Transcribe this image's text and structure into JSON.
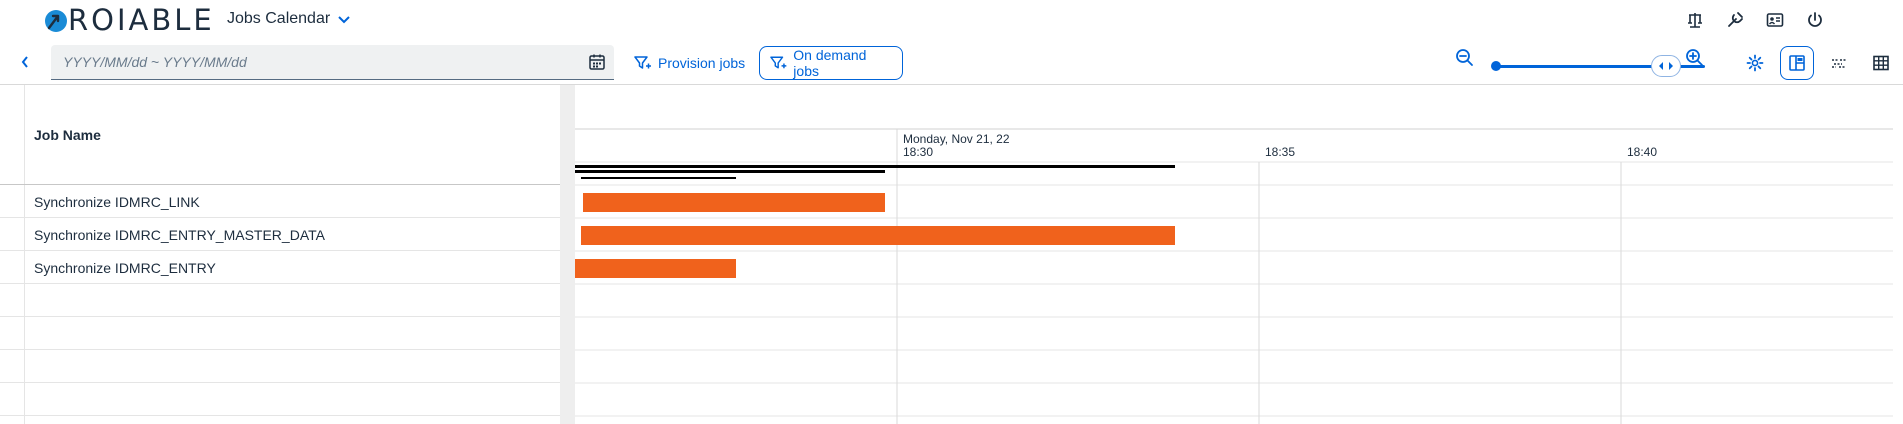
{
  "header": {
    "logo_text": "ROIABLE",
    "app_title": "Jobs Calendar",
    "actions": [
      {
        "name": "balance-scale-icon"
      },
      {
        "name": "tools-icon"
      },
      {
        "name": "id-card-icon"
      },
      {
        "name": "power-icon"
      }
    ]
  },
  "toolbar": {
    "date_placeholder": "YYYY/MM/dd ~ YYYY/MM/dd",
    "date_value": "",
    "provision_label": "Provision jobs",
    "on_demand_label": "On demand jobs",
    "view_modes": [
      "gantt-view-icon",
      "timeline-view-icon",
      "table-view-icon"
    ],
    "active_view": "gantt-view-icon"
  },
  "table": {
    "column_header": "Job Name",
    "rows": [
      "Synchronize IDMRC_LINK",
      "Synchronize IDMRC_ENTRY_MASTER_DATA",
      "Synchronize IDMRC_ENTRY",
      "",
      "",
      "",
      ""
    ]
  },
  "gantt": {
    "day_label": "Monday, Nov 21, 22",
    "time_labels": [
      "18:30",
      "18:35",
      "18:40"
    ],
    "bar_color": "#f0621c",
    "summary_color": "#000000"
  },
  "colors": {
    "accent": "#0064d9",
    "text": "#1d2d3e",
    "bar": "#f0621c"
  }
}
